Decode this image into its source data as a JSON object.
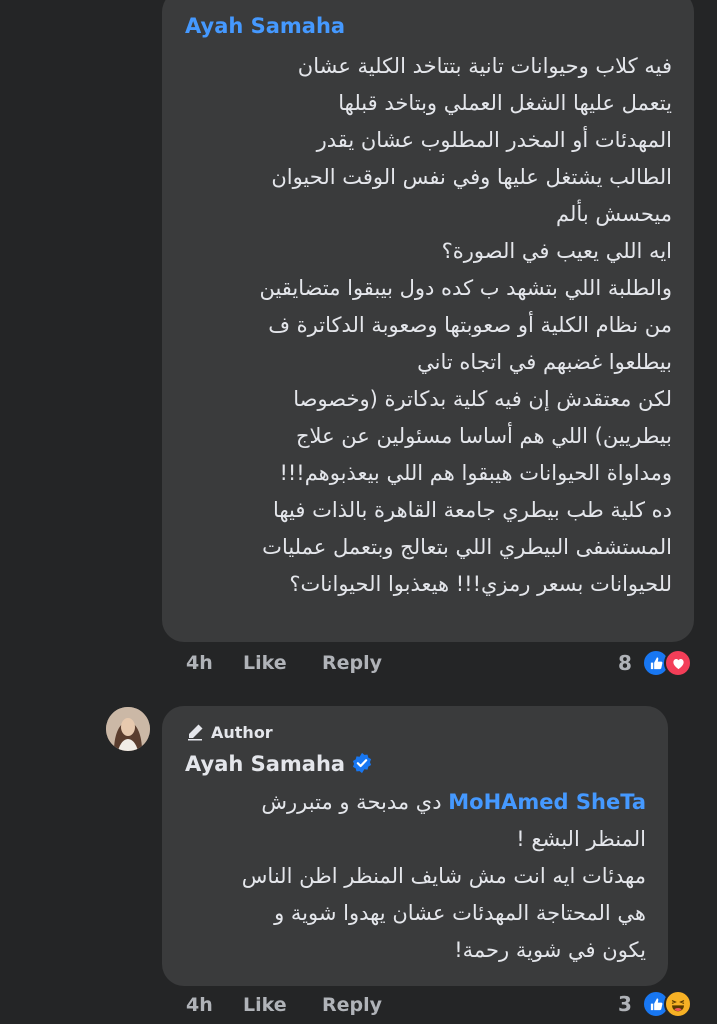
{
  "comment1": {
    "author": "Ayah Samaha",
    "lines": [
      "فيه كلاب وحيوانات تانية بتتاخد الكلية عشان",
      "يتعمل عليها الشغل العملي وبتاخد قبلها",
      "المهدئات أو المخدر المطلوب عشان يقدر",
      "الطالب يشتغل عليها وفي نفس الوقت الحيوان",
      "ميحسش بألم",
      "ايه اللي يعيب في الصورة؟",
      "والطلبة اللي بتشهد ب كده دول بيبقوا متضايقين",
      "من نظام الكلية أو صعوبتها وصعوبة الدكاترة ف",
      "بيطلعوا غضبهم في اتجاه تاني",
      "لكن معتقدش إن فيه كلية بدكاترة (وخصوصا",
      "بيطريين) اللي هم أساسا مسئولين عن علاج",
      "ومداواة الحيوانات هيبقوا هم اللي بيعذبوهم!!!",
      "ده كلية طب بيطري جامعة القاهرة بالذات فيها",
      "المستشفى البيطري اللي بتعالج وبتعمل عمليات",
      "للحيوانات بسعر رمزي!!! هيعذبوا الحيوانات؟"
    ],
    "time": "4h",
    "like_label": "Like",
    "reply_label": "Reply",
    "reaction_count": "8",
    "reactions": [
      "like-icon",
      "love-icon"
    ]
  },
  "comment2": {
    "author_tag": "Author",
    "author": "Ayah Samaha",
    "mention": "MoHAmed SheTa",
    "first_line_rest": "دي مدبحة و متبررش",
    "lines": [
      "المنظر البشع !",
      "مهدئات ايه انت مش شايف المنظر اظن الناس",
      "هي المحتاجة المهدئات عشان يهدوا شوية و",
      "يكون في شوية رحمة!"
    ],
    "time": "4h",
    "like_label": "Like",
    "reply_label": "Reply",
    "reaction_count": "3",
    "reactions": [
      "like-icon",
      "haha-icon"
    ]
  },
  "colors": {
    "background": "#242526",
    "bubble": "#3a3b3c",
    "link": "#4599ff",
    "like_blue": "#1877f2",
    "love_red": "#f33e58",
    "haha_yellow": "#f7b125"
  }
}
